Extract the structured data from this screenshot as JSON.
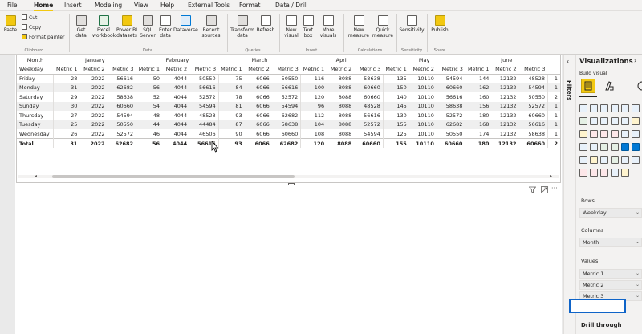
{
  "menu": {
    "tabs": [
      "File",
      "Home",
      "Insert",
      "Modeling",
      "View",
      "Help",
      "External Tools",
      "Format",
      "Data / Drill"
    ]
  },
  "ribbon": {
    "clipboard": {
      "paste": "Paste",
      "cut": "Cut",
      "copy": "Copy",
      "format_painter": "Format painter",
      "group": "Clipboard"
    },
    "data": {
      "get_data": "Get data",
      "excel": "Excel workbook",
      "pbi": "Power BI datasets",
      "sql": "SQL Server",
      "enter": "Enter data",
      "dataverse": "Dataverse",
      "recent": "Recent sources",
      "group": "Data"
    },
    "queries": {
      "transform": "Transform data",
      "refresh": "Refresh",
      "group": "Queries"
    },
    "insert": {
      "new_visual": "New visual",
      "text_box": "Text box",
      "more": "More visuals",
      "group": "Insert"
    },
    "calc": {
      "new_measure": "New measure",
      "quick_measure": "Quick measure",
      "group": "Calculations"
    },
    "sensitivity": {
      "label": "Sensitivity",
      "group": "Sensitivity"
    },
    "share": {
      "publish": "Publish",
      "group": "Share"
    }
  },
  "matrix": {
    "corner_top": "Month",
    "corner_bottom": "Weekday",
    "months": [
      "January",
      "February",
      "March",
      "April",
      "May",
      "June"
    ],
    "metrics": [
      "Metric 1",
      "Metric 2",
      "Metric 3"
    ],
    "rows": [
      {
        "label": "Friday",
        "values": [
          "28",
          "2022",
          "56616",
          "50",
          "4044",
          "50550",
          "75",
          "6066",
          "50550",
          "116",
          "8088",
          "58638",
          "135",
          "10110",
          "54594",
          "144",
          "12132",
          "48528",
          "1"
        ]
      },
      {
        "label": "Monday",
        "values": [
          "31",
          "2022",
          "62682",
          "56",
          "4044",
          "56616",
          "84",
          "6066",
          "56616",
          "100",
          "8088",
          "60660",
          "150",
          "10110",
          "60660",
          "162",
          "12132",
          "54594",
          "1"
        ]
      },
      {
        "label": "Saturday",
        "values": [
          "29",
          "2022",
          "58638",
          "52",
          "4044",
          "52572",
          "78",
          "6066",
          "52572",
          "120",
          "8088",
          "60660",
          "140",
          "10110",
          "56616",
          "160",
          "12132",
          "50550",
          "2"
        ]
      },
      {
        "label": "Sunday",
        "values": [
          "30",
          "2022",
          "60660",
          "54",
          "4044",
          "54594",
          "81",
          "6066",
          "54594",
          "96",
          "8088",
          "48528",
          "145",
          "10110",
          "58638",
          "156",
          "12132",
          "52572",
          "1"
        ]
      },
      {
        "label": "Thursday",
        "values": [
          "27",
          "2022",
          "54594",
          "48",
          "4044",
          "48528",
          "93",
          "6066",
          "62682",
          "112",
          "8088",
          "56616",
          "130",
          "10110",
          "52572",
          "180",
          "12132",
          "60660",
          "1"
        ]
      },
      {
        "label": "Tuesday",
        "values": [
          "25",
          "2022",
          "50550",
          "44",
          "4044",
          "44484",
          "87",
          "6066",
          "58638",
          "104",
          "8088",
          "52572",
          "155",
          "10110",
          "62682",
          "168",
          "12132",
          "56616",
          "1"
        ]
      },
      {
        "label": "Wednesday",
        "values": [
          "26",
          "2022",
          "52572",
          "46",
          "4044",
          "46506",
          "90",
          "6066",
          "60660",
          "108",
          "8088",
          "54594",
          "125",
          "10110",
          "50550",
          "174",
          "12132",
          "58638",
          "1"
        ]
      }
    ],
    "total": {
      "label": "Total",
      "values": [
        "31",
        "2022",
        "62682",
        "56",
        "4044",
        "56616",
        "93",
        "6066",
        "62682",
        "120",
        "8088",
        "60660",
        "155",
        "10110",
        "60660",
        "180",
        "12132",
        "60660",
        "2"
      ]
    }
  },
  "visual_header": {
    "filter_icon": "filter-icon",
    "focus_icon": "focus-icon",
    "more": "···"
  },
  "panes": {
    "filters": "Filters",
    "viz_title": "Visualizations",
    "build_visual": "Build visual",
    "rows_label": "Rows",
    "rows_field": "Weekday",
    "columns_label": "Columns",
    "columns_field": "Month",
    "values_label": "Values",
    "values_fields": [
      "Metric 1",
      "Metric 2",
      "Metric 3"
    ],
    "drill_through": "Drill through"
  },
  "colors": {
    "accent": "#f2c811",
    "highlight": "#0f64c8"
  }
}
